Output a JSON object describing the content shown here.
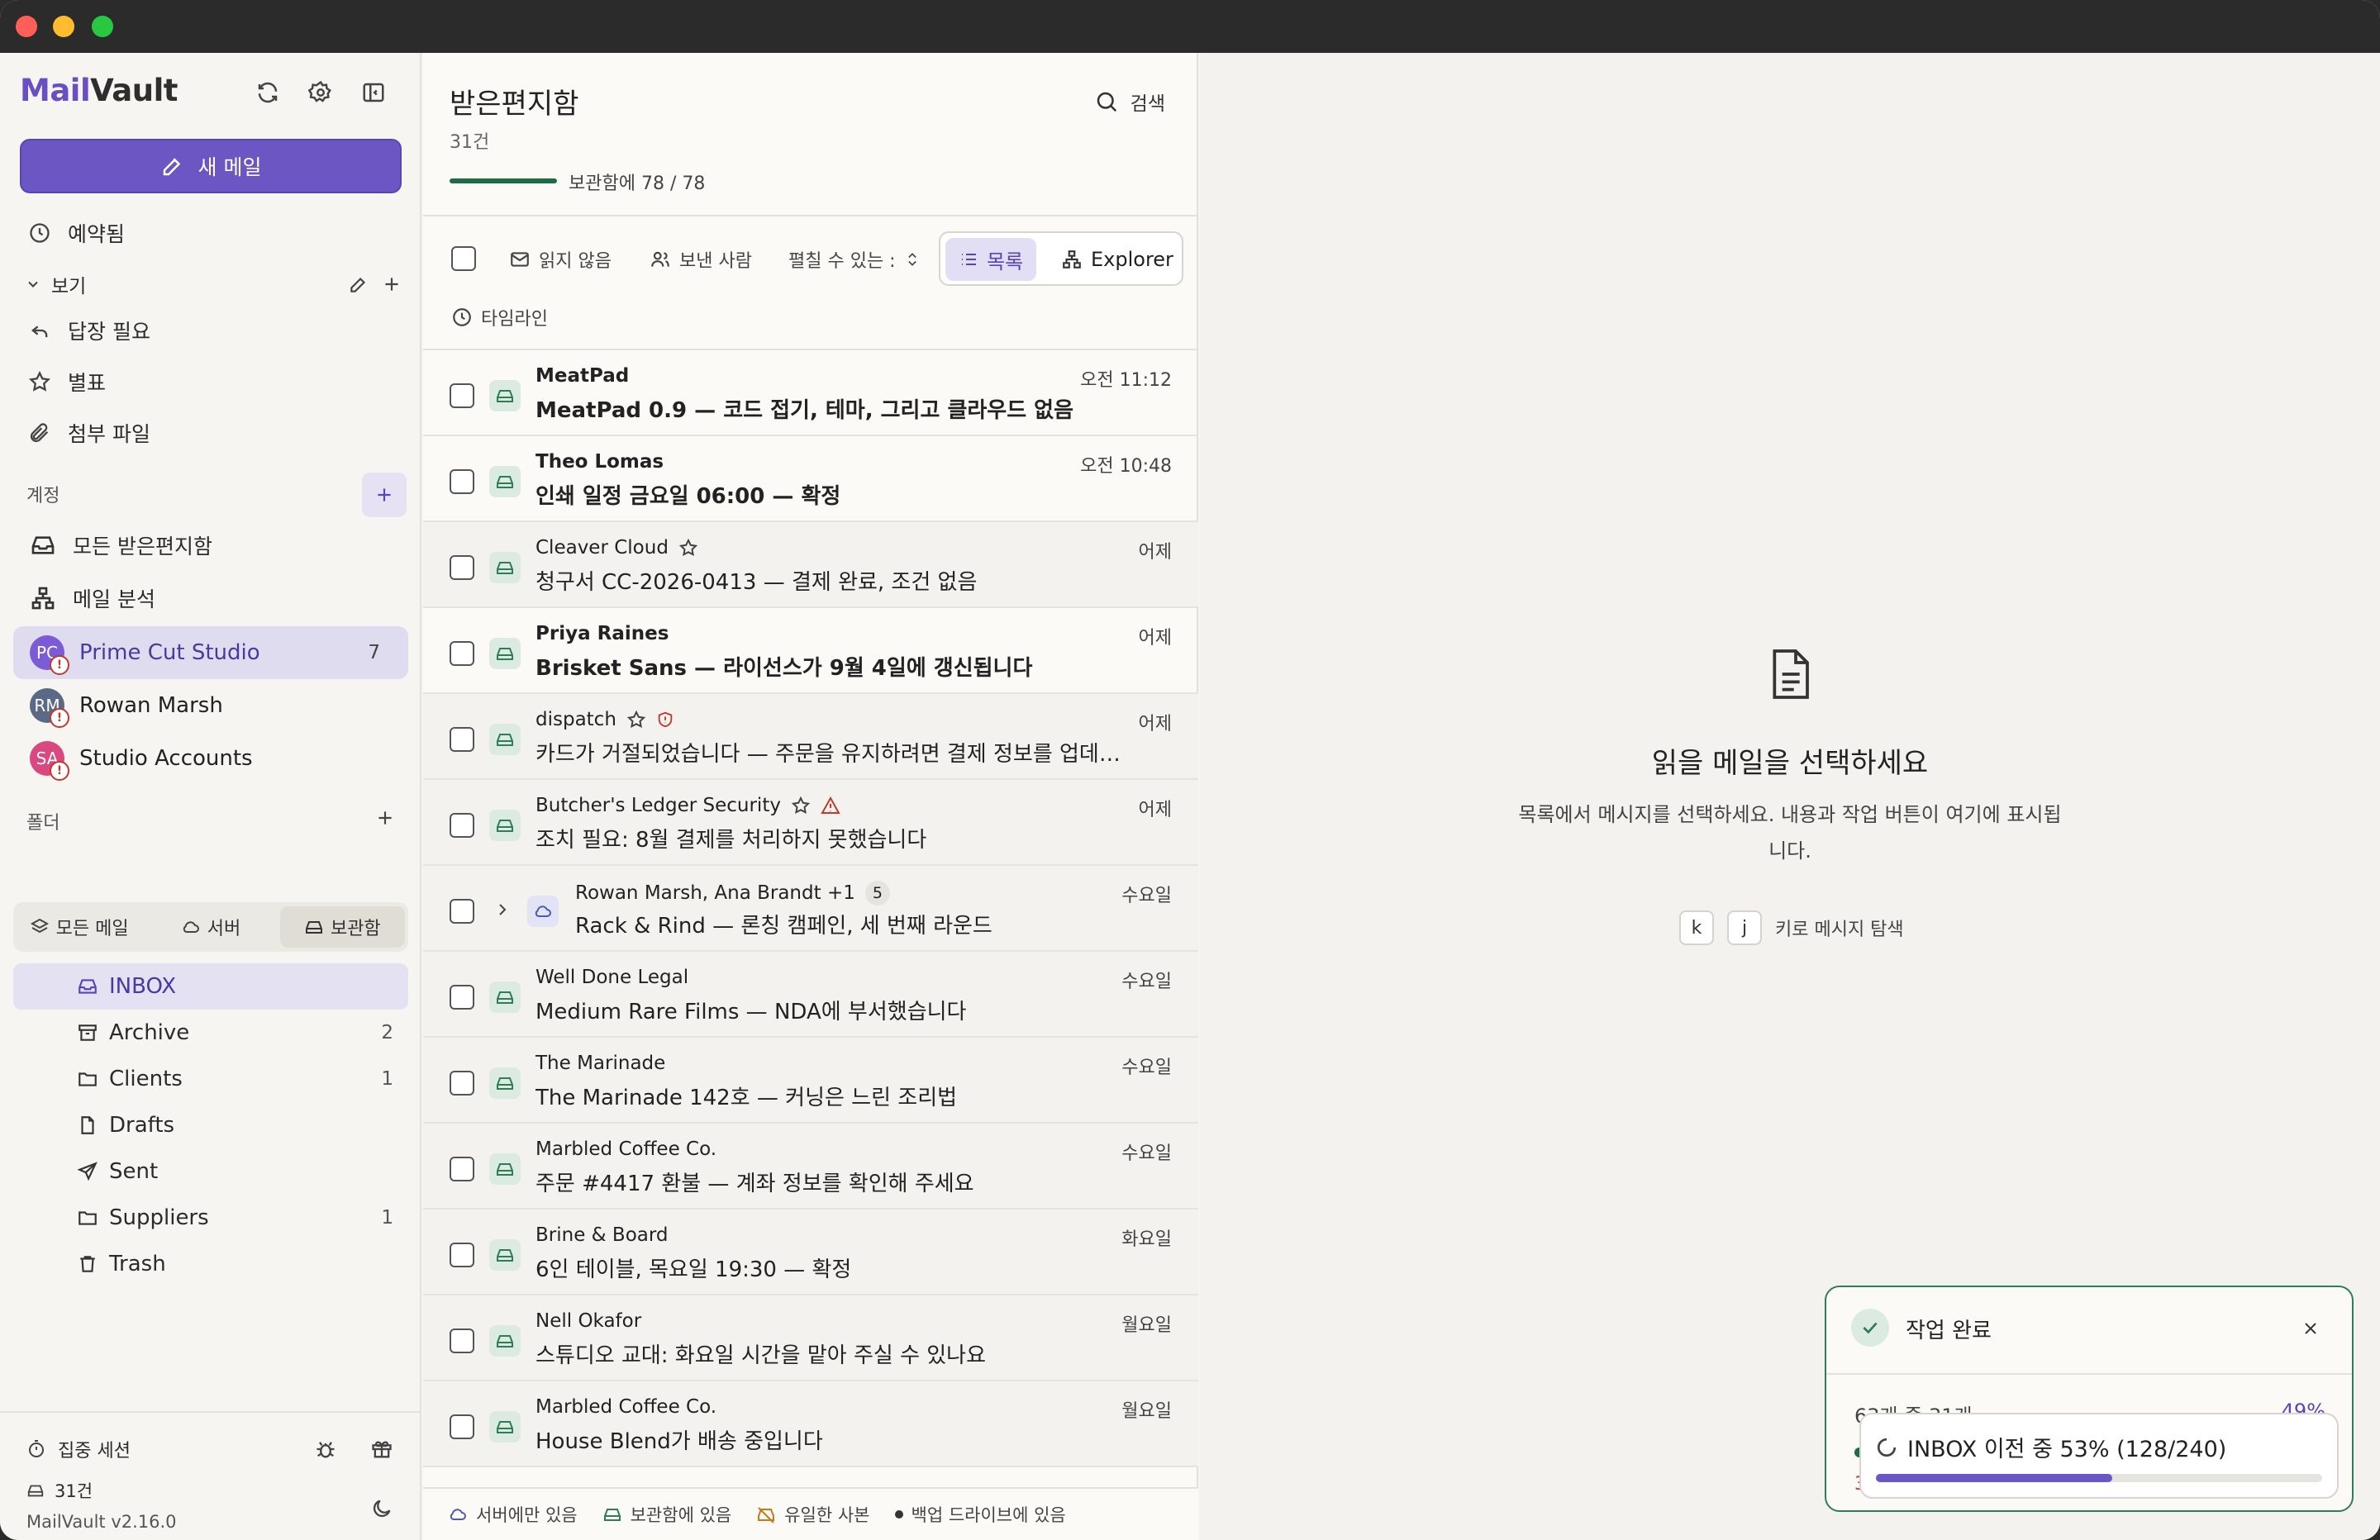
{
  "app": {
    "logo_part1": "Mail",
    "logo_part2": "Vault",
    "compose_label": "새 메일",
    "version": "MailVault v2.16.0"
  },
  "sidebar": {
    "scheduled": "예약됨",
    "views_label": "보기",
    "views": [
      "답장 필요",
      "별표",
      "첨부 파일"
    ],
    "accounts_label": "계정",
    "account_links": [
      "모든 받은편지함",
      "메일 분석"
    ],
    "accounts": [
      {
        "name": "Prime Cut Studio",
        "initials": "PC",
        "count": "7",
        "color": "#7b5cd6"
      },
      {
        "name": "Rowan Marsh",
        "initials": "RM",
        "count": "",
        "color": "#5a6a86"
      },
      {
        "name": "Studio Accounts",
        "initials": "SA",
        "count": "",
        "color": "#d9487f"
      }
    ],
    "folders_label": "폴더",
    "segments": [
      "모든 메일",
      "서버",
      "보관함"
    ],
    "folders": [
      {
        "name": "INBOX",
        "count": ""
      },
      {
        "name": "Archive",
        "count": "2"
      },
      {
        "name": "Clients",
        "count": "1"
      },
      {
        "name": "Drafts",
        "count": ""
      },
      {
        "name": "Sent",
        "count": ""
      },
      {
        "name": "Suppliers",
        "count": "1"
      },
      {
        "name": "Trash",
        "count": ""
      }
    ],
    "focus_session": "집중 세션",
    "vault_count": "31건"
  },
  "list": {
    "title": "받은편지함",
    "count": "31건",
    "search_label": "검색",
    "progress_label": "보관함에 78 / 78",
    "progress_fraction": 1.0,
    "filter_unread": "읽지 않음",
    "filter_sender": "보낸 사람",
    "filter_expandable": "펼칠 수 있는 :",
    "view_list": "목록",
    "view_explorer": "Explorer",
    "timeline": "타임라인",
    "rows": [
      {
        "sender": "MeatPad",
        "subject": "MeatPad 0.9 — 코드 접기, 테마, 그리고 클라우드 없음",
        "date": "오전 11:12",
        "unread": true,
        "star": false,
        "badge": "",
        "thread": ""
      },
      {
        "sender": "Theo Lomas",
        "subject": "인쇄 일정 금요일 06:00 — 확정",
        "date": "오전 10:48",
        "unread": true,
        "star": false,
        "badge": "",
        "thread": ""
      },
      {
        "sender": "Cleaver Cloud",
        "subject": "청구서 CC-2026-0413 — 결제 완료, 조건 없음",
        "date": "어제",
        "unread": false,
        "star": true,
        "badge": "",
        "thread": ""
      },
      {
        "sender": "Priya Raines",
        "subject": "Brisket Sans — 라이선스가 9월 4일에 갱신됩니다",
        "date": "어제",
        "unread": true,
        "star": false,
        "badge": "",
        "thread": ""
      },
      {
        "sender": "dispatch",
        "subject": "카드가 거절되었습니다 — 주문을 유지하려면 결제 정보를 업데이트하...",
        "date": "어제",
        "unread": false,
        "star": true,
        "badge": "shield",
        "thread": ""
      },
      {
        "sender": "Butcher's Ledger Security",
        "subject": "조치 필요: 8월 결제를 처리하지 못했습니다",
        "date": "어제",
        "unread": false,
        "star": true,
        "badge": "warning",
        "thread": ""
      },
      {
        "sender": "Rowan Marsh, Ana Brandt +1",
        "subject": "Rack & Rind — 론칭 캠페인, 세 번째 라운드",
        "date": "수요일",
        "unread": false,
        "star": false,
        "badge": "",
        "thread": "5"
      },
      {
        "sender": "Well Done Legal",
        "subject": "Medium Rare Films — NDA에 부서했습니다",
        "date": "수요일",
        "unread": false,
        "star": false,
        "badge": "",
        "thread": ""
      },
      {
        "sender": "The Marinade",
        "subject": "The Marinade 142호 — 커닝은 느린 조리법",
        "date": "수요일",
        "unread": false,
        "star": false,
        "badge": "",
        "thread": ""
      },
      {
        "sender": "Marbled Coffee Co.",
        "subject": "주문 #4417 환불 — 계좌 정보를 확인해 주세요",
        "date": "수요일",
        "unread": false,
        "star": false,
        "badge": "",
        "thread": ""
      },
      {
        "sender": "Brine & Board",
        "subject": "6인 테이블, 목요일 19:30 — 확정",
        "date": "화요일",
        "unread": false,
        "star": false,
        "badge": "",
        "thread": ""
      },
      {
        "sender": "Nell Okafor",
        "subject": "스튜디오 교대: 화요일 시간을 맡아 주실 수 있나요",
        "date": "월요일",
        "unread": false,
        "star": false,
        "badge": "",
        "thread": ""
      },
      {
        "sender": "Marbled Coffee Co.",
        "subject": "House Blend가 배송 중입니다",
        "date": "월요일",
        "unread": false,
        "star": false,
        "badge": "",
        "thread": ""
      }
    ],
    "legend": [
      "서버에만 있음",
      "보관함에 있음",
      "유일한 사본",
      "백업 드라이브에 있음"
    ]
  },
  "reader": {
    "empty_title": "읽을 메일을 선택하세요",
    "empty_body": "목록에서 메시지를 선택하세요. 내용과 작업 버튼이 여기에 표시됩니다.",
    "key1": "k",
    "key2": "j",
    "key_hint": "키로 메시지 탐색"
  },
  "toast": {
    "title": "작업 완료",
    "progress_text": "63개 중 31개",
    "progress_pct": "49%",
    "hidden_digit": "3",
    "inner_text": "INBOX 이전 중 53% (128/240)",
    "inner_fraction": 0.53
  }
}
